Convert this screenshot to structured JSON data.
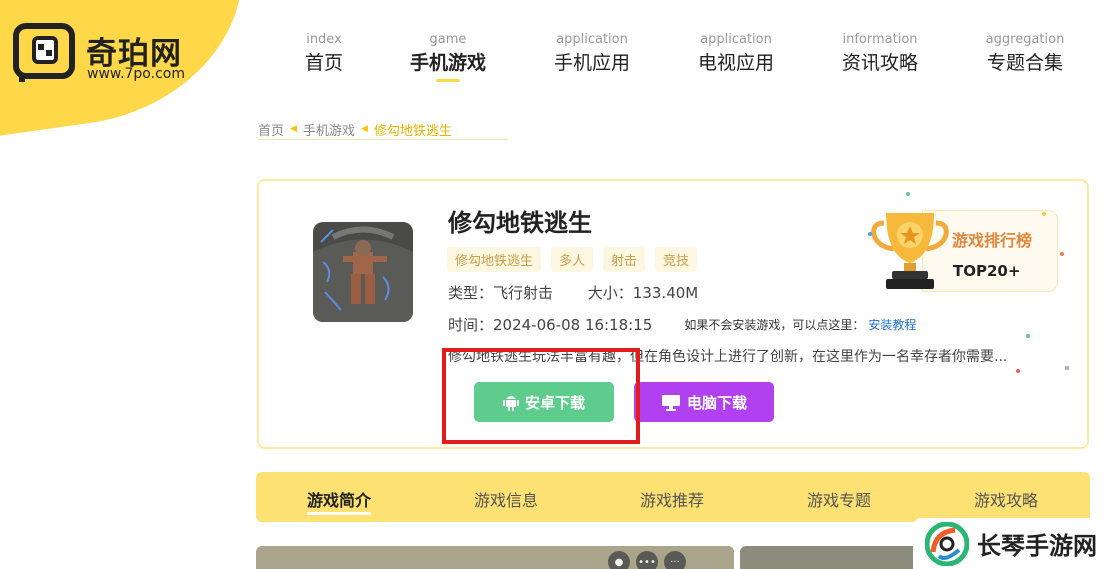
{
  "logo": {
    "name": "奇珀网",
    "url": "www.7po.com"
  },
  "nav": [
    {
      "en": "index",
      "cn": "首页"
    },
    {
      "en": "game",
      "cn": "手机游戏"
    },
    {
      "en": "application",
      "cn": "手机应用"
    },
    {
      "en": "application",
      "cn": "电视应用"
    },
    {
      "en": "information",
      "cn": "资讯攻略"
    },
    {
      "en": "aggregation",
      "cn": "专题合集"
    }
  ],
  "breadcrumb": {
    "home": "首页",
    "category": "手机游戏",
    "current": "修勾地铁逃生"
  },
  "game": {
    "title": "修勾地铁逃生",
    "tags": [
      "修勾地铁逃生",
      "多人",
      "射击",
      "竞技"
    ],
    "type": "类型：飞行射击",
    "size": "大小：133.40M",
    "time": "时间：2024-06-08 16:18:15",
    "install_hint": "如果不会安装游戏，可以点这里：",
    "install_link": "安装教程",
    "description": "修勾地铁逃生玩法丰富有趣，但在角色设计上进行了创新，在这里作为一名幸存者你需要..."
  },
  "buttons": {
    "android": "安卓下载",
    "pc": "电脑下载"
  },
  "ranking": {
    "title": "游戏排行榜",
    "rank": "TOP20+"
  },
  "tabs": [
    "游戏简介",
    "游戏信息",
    "游戏推荐",
    "游戏专题",
    "游戏攻略"
  ],
  "watermark": {
    "text": "长琴手游网"
  },
  "colors": {
    "brand_yellow": "#ffd84a",
    "android_green": "#5dcc8c",
    "pc_purple": "#b040f0",
    "highlight_red": "#e21b1b"
  }
}
